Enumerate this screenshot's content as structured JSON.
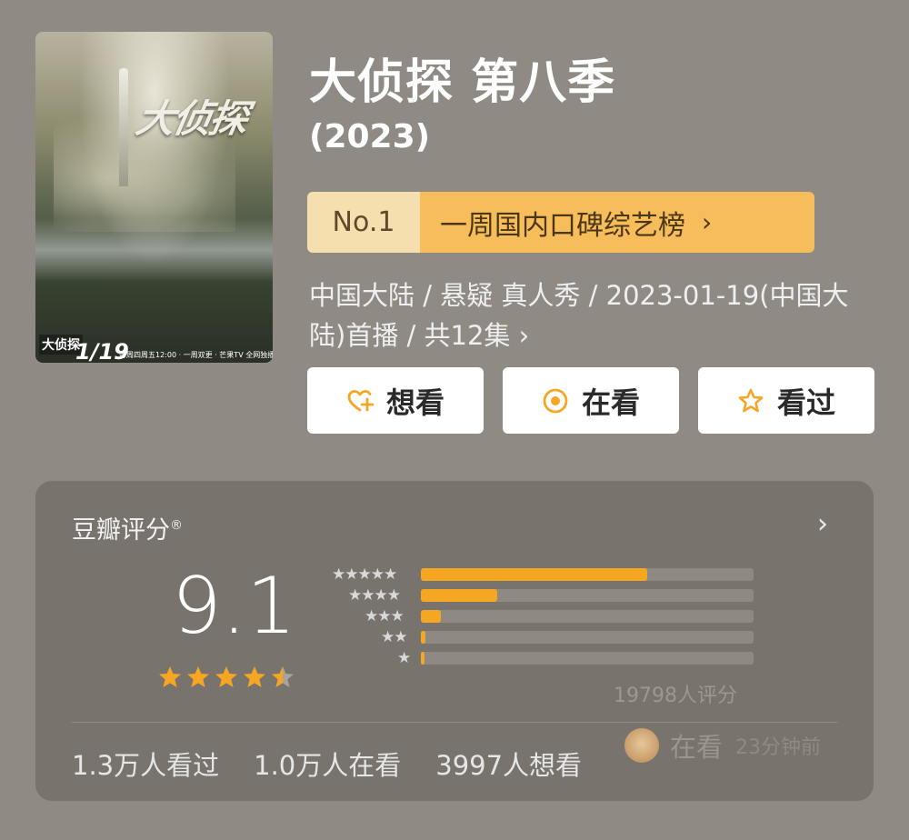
{
  "poster": {
    "logo_text": "大侦探",
    "small_logo": "大侦探",
    "date": "1/19",
    "schedule": "每周四周五12:00 · 一周双更 · 芒果TV 全网独播"
  },
  "show": {
    "title": "大侦探 第八季",
    "year": "(2023)"
  },
  "ranking": {
    "rank": "No.1",
    "list_name": "一周国内口碑综艺榜",
    "chevron": "›"
  },
  "meta": {
    "info": "中国大陆 / 悬疑 真人秀 / 2023-01-19(中国大陆)首播 / 共12集 ›"
  },
  "actions": {
    "want_label": "想看",
    "watching_label": "在看",
    "watched_label": "看过"
  },
  "rating": {
    "label": "豆瓣评分",
    "registered_mark": "®",
    "more": "›",
    "score": "9.1",
    "stars_value": 4.5,
    "breakdown": [
      {
        "stars": "★★★★★",
        "fraction": 0.68
      },
      {
        "stars": "★★★★",
        "fraction": 0.23
      },
      {
        "stars": "★★★",
        "fraction": 0.06
      },
      {
        "stars": "★★",
        "fraction": 0.015
      },
      {
        "stars": "★",
        "fraction": 0.01
      }
    ],
    "count": "19798人评分"
  },
  "stats": {
    "watched": "1.3万人看过",
    "watching": "1.0万人在看",
    "want": "3997人想看"
  },
  "activity": {
    "status": "在看",
    "time": "23分钟前"
  },
  "colors": {
    "background": "#8f8b84",
    "panel": "#78736c",
    "accent": "#f5a623",
    "rank_light": "#f6dfae",
    "rank_dark": "#f6bd5a"
  }
}
